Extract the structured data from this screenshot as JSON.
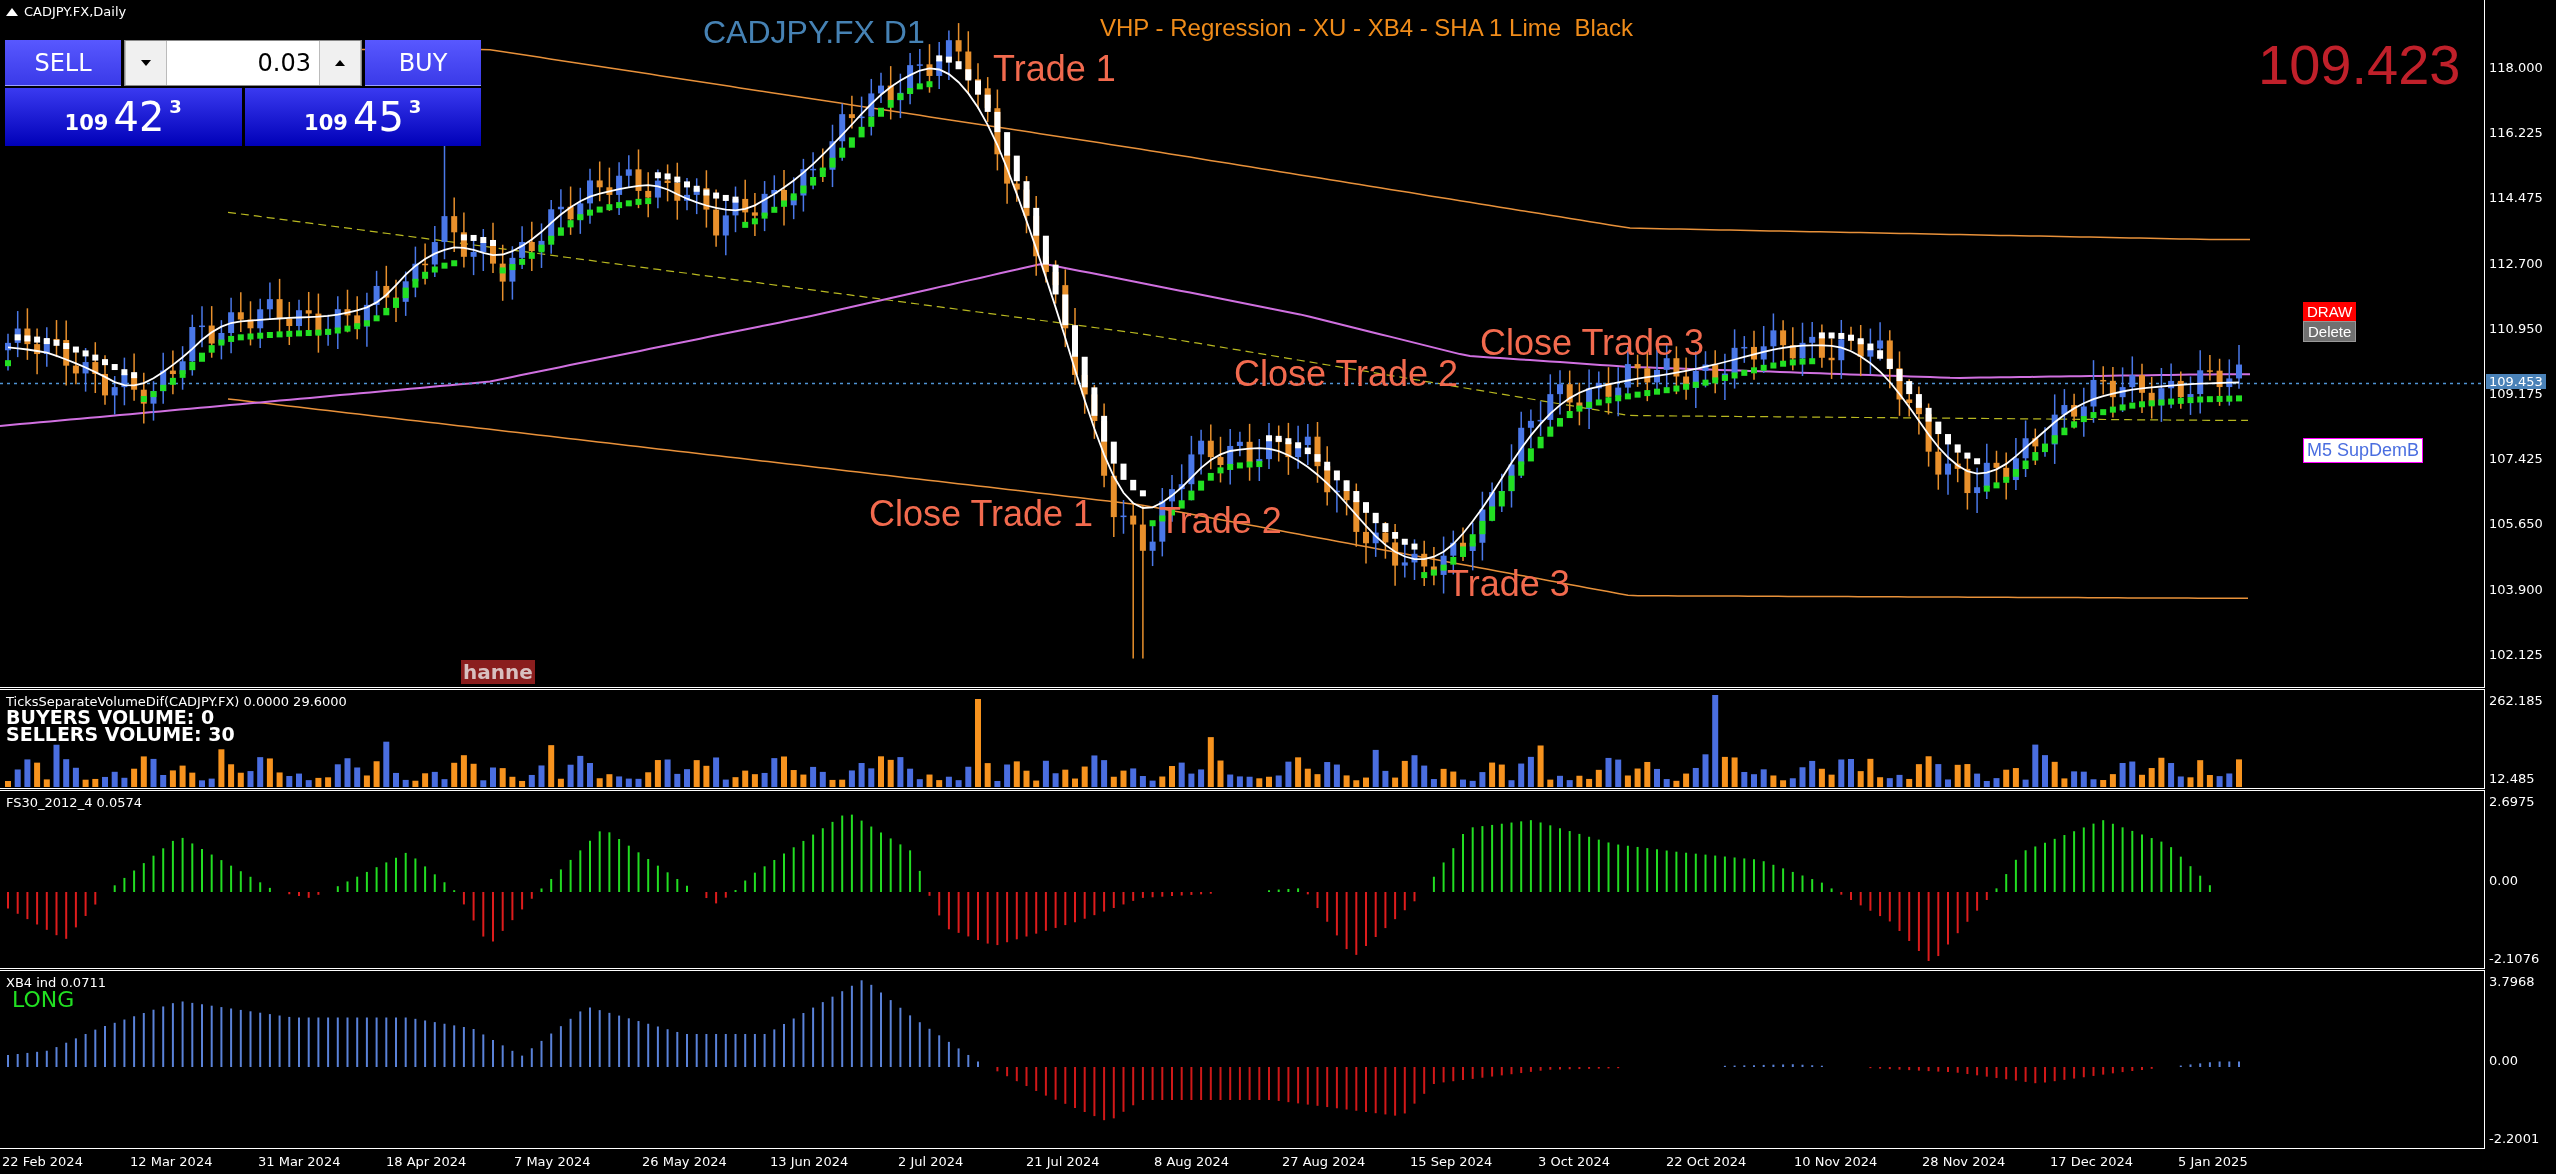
{
  "chart_window": {
    "title": "CADJPY.FX,Daily"
  },
  "trade_panel": {
    "sell_label": "SELL",
    "buy_label": "BUY",
    "lot": "0.03",
    "bid": {
      "big": "109",
      "main": "42",
      "point": "3"
    },
    "ask": {
      "big": "109",
      "main": "45",
      "point": "3"
    }
  },
  "main_chart": {
    "symbol": "CADJPY.FX D1",
    "indicators": "VHP - Regression - XU - XB4 - SHA 1 Lime  Black",
    "last_price": "109.423",
    "annotations": [
      "Trade 1",
      "Close Trade 3",
      "Close Trade 2",
      "Close Trade 1",
      "Trade 2",
      "Trade 3"
    ],
    "buttons": [
      {
        "label": "DRAW",
        "kind": "draw"
      },
      {
        "label": "Delete",
        "kind": "delete"
      }
    ],
    "zone_label": "M5 SupDemB",
    "cut_label": "hanne",
    "price_axis": [
      "118.000",
      "116.225",
      "114.475",
      "112.700",
      "110.950",
      "109.175",
      "107.425",
      "105.650",
      "103.900",
      "102.125"
    ],
    "current_price": "109.453"
  },
  "volume_panel": {
    "title": "TicksSeparateVolumeDif(CADJPY.FX) 0.0000 29.6000",
    "buyers": "BUYERS VOLUME: 0",
    "sellers": "SELLERS VOLUME: 30",
    "axis": [
      "262.185",
      "12.485"
    ]
  },
  "fs30_panel": {
    "title": "FS30_2012_4 0.0574",
    "axis": [
      "2.6975",
      "0.00",
      "-2.1076"
    ]
  },
  "xb4_panel": {
    "title": "XB4 ind 0.0711",
    "signal": "LONG",
    "axis": [
      "3.7968",
      "0.00",
      "-2.2001"
    ]
  },
  "time_axis": [
    "22 Feb 2024",
    "12 Mar 2024",
    "31 Mar 2024",
    "18 Apr 2024",
    "7 May 2024",
    "26 May 2024",
    "13 Jun 2024",
    "2 Jul 2024",
    "21 Jul 2024",
    "8 Aug 2024",
    "27 Aug 2024",
    "15 Sep 2024",
    "3 Oct 2024",
    "22 Oct 2024",
    "10 Nov 2024",
    "28 Nov 2024",
    "17 Dec 2024",
    "5 Jan 2025"
  ]
}
